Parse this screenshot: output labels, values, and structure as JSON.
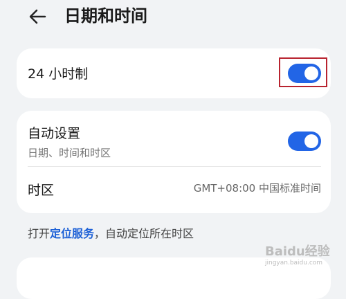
{
  "header": {
    "title": "日期和时间"
  },
  "settings": {
    "hour24": {
      "label": "24 小时制",
      "enabled": true
    },
    "auto": {
      "label": "自动设置",
      "sublabel": "日期、时间和时区",
      "enabled": true
    },
    "timezone": {
      "label": "时区",
      "value": "GMT+08:00 中国标准时间"
    }
  },
  "footer": {
    "prefix": "打开",
    "link": "定位服务",
    "suffix": "，自动定位所在时区"
  },
  "watermark": {
    "brand": "Baidu经验",
    "url": "jingyan.baidu.com"
  },
  "colors": {
    "accent": "#2265e6",
    "highlight": "#b8232f",
    "background": "#f1f3f5"
  },
  "icons": {
    "back": "arrow-left-icon"
  }
}
